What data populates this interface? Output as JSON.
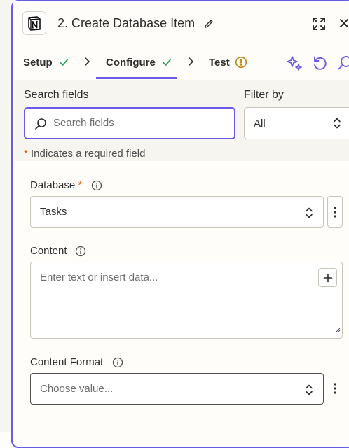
{
  "header": {
    "title": "2. Create Database Item",
    "app_icon": "notion-icon"
  },
  "tabs": [
    {
      "label": "Setup",
      "status": "complete"
    },
    {
      "label": "Configure",
      "status": "complete",
      "active": true
    },
    {
      "label": "Test",
      "status": "warning"
    }
  ],
  "toolbar_icons": [
    "sparkle-icon",
    "refresh-icon",
    "search-icon"
  ],
  "search": {
    "label": "Search fields",
    "placeholder": "Search fields",
    "value": "",
    "filter_label": "Filter by",
    "filter_value": "All"
  },
  "required_note": {
    "asterisk": "*",
    "text": "Indicates a required field"
  },
  "fields": {
    "database": {
      "label": "Database",
      "required_mark": "*",
      "value": "Tasks"
    },
    "content": {
      "label": "Content",
      "placeholder": "Enter text or insert data..."
    },
    "content_format": {
      "label": "Content Format",
      "placeholder": "Choose value..."
    }
  },
  "colors": {
    "accent": "#695be8",
    "complete_check": "#2e9f5f",
    "warning": "#b8860b",
    "required": "#e8590c",
    "background": "#fffdf9",
    "search_area": "#f7f5f0"
  }
}
